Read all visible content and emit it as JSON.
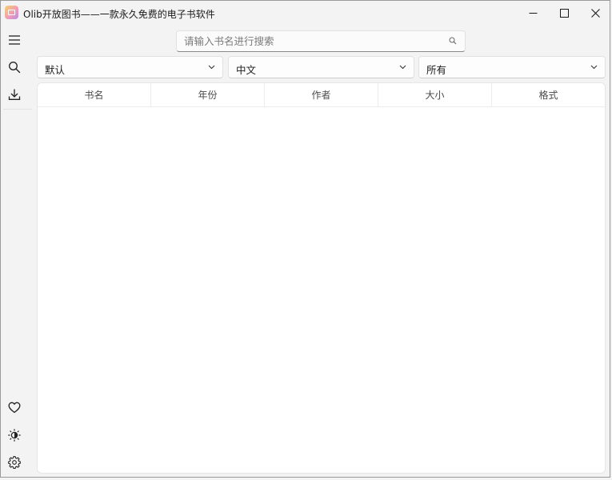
{
  "window": {
    "title": "Olib开放图书——一款永久免费的电子书软件"
  },
  "sidebar": {
    "top_items": [
      {
        "icon": "menu-icon"
      },
      {
        "icon": "search-icon"
      },
      {
        "icon": "download-icon"
      }
    ],
    "bottom_items": [
      {
        "icon": "heart-icon"
      },
      {
        "icon": "theme-toggle-icon"
      },
      {
        "icon": "gear-icon"
      }
    ]
  },
  "search": {
    "placeholder": "请输入书名进行搜索",
    "value": ""
  },
  "filters": {
    "sort": "默认",
    "language": "中文",
    "format": "所有"
  },
  "table": {
    "columns": [
      "书名",
      "年份",
      "作者",
      "大小",
      "格式"
    ],
    "rows": []
  },
  "colors": {
    "background": "#f3f3f3",
    "panel": "#ffffff",
    "border": "#e6e6e6"
  }
}
